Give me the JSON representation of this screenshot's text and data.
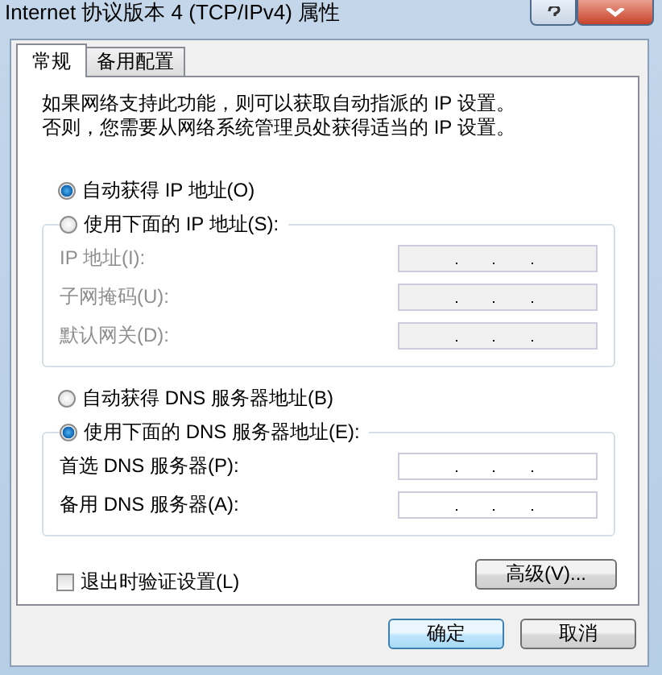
{
  "window": {
    "title": "Internet 协议版本 4 (TCP/IPv4) 属性"
  },
  "tabs": [
    {
      "label": "常规",
      "selected": true
    },
    {
      "label": "备用配置",
      "selected": false
    }
  ],
  "intro": "如果网络支持此功能，则可以获取自动指派的 IP 设置。否则，您需要从网络系统管理员处获得适当的 IP 设置。",
  "ip_section": {
    "options": [
      {
        "label": "自动获得 IP 地址(O)",
        "selected": true
      },
      {
        "label": "使用下面的 IP 地址(S):",
        "selected": false
      }
    ],
    "fields": [
      {
        "label": "IP 地址(I):",
        "disabled": true
      },
      {
        "label": "子网掩码(U):",
        "disabled": true
      },
      {
        "label": "默认网关(D):",
        "disabled": true
      }
    ]
  },
  "dns_section": {
    "options": [
      {
        "label": "自动获得 DNS 服务器地址(B)",
        "selected": false
      },
      {
        "label": "使用下面的 DNS 服务器地址(E):",
        "selected": true
      }
    ],
    "fields": [
      {
        "label": "首选 DNS 服务器(P):",
        "disabled": false
      },
      {
        "label": "备用 DNS 服务器(A):",
        "disabled": false
      }
    ]
  },
  "validate_checkbox": {
    "label": "退出时验证设置(L)",
    "checked": false
  },
  "advanced_button": "高级(V)...",
  "buttons": [
    {
      "label": "确定",
      "default": true
    },
    {
      "label": "取消",
      "default": false
    }
  ]
}
